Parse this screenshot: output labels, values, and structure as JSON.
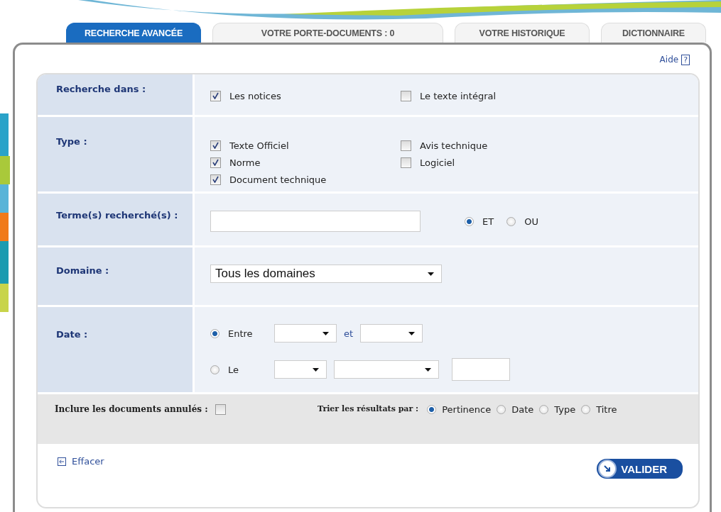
{
  "tabs": [
    {
      "label": "RECHERCHE AVANCÉE",
      "selected": true
    },
    {
      "label": "VOTRE PORTE-DOCUMENTS : 0",
      "selected": false
    },
    {
      "label": "VOTRE HISTORIQUE",
      "selected": false
    },
    {
      "label": "DICTIONNAIRE",
      "selected": false
    }
  ],
  "help": {
    "label": "Aide",
    "key": "?"
  },
  "search_in": {
    "label": "Recherche dans :",
    "options": [
      {
        "label": "Les notices",
        "checked": true
      },
      {
        "label": "Le texte intégral",
        "checked": false
      }
    ]
  },
  "type": {
    "label": "Type :",
    "options": [
      {
        "label": "Texte Officiel",
        "checked": true
      },
      {
        "label": "Norme",
        "checked": true
      },
      {
        "label": "Document technique",
        "checked": true
      },
      {
        "label": "Avis technique",
        "checked": false
      },
      {
        "label": "Logiciel",
        "checked": false
      }
    ]
  },
  "terms": {
    "label": "Terme(s) recherché(s) :",
    "operators": [
      {
        "label": "ET",
        "selected": true
      },
      {
        "label": "OU",
        "selected": false
      }
    ]
  },
  "domain": {
    "label": "Domaine :",
    "value": "Tous les domaines"
  },
  "date": {
    "label": "Date :",
    "between": {
      "label": "Entre",
      "selected": true,
      "connector": "et"
    },
    "on": {
      "label": "Le",
      "selected": false
    }
  },
  "include_cancelled": {
    "label": "Inclure les documents annulés :",
    "checked": false
  },
  "sort": {
    "label": "Trier les résultats par :",
    "options": [
      {
        "label": "Pertinence",
        "selected": true
      },
      {
        "label": "Date",
        "selected": false
      },
      {
        "label": "Type",
        "selected": false
      },
      {
        "label": "Titre",
        "selected": false
      }
    ]
  },
  "clear": "Effacer",
  "submit": "VALIDER"
}
